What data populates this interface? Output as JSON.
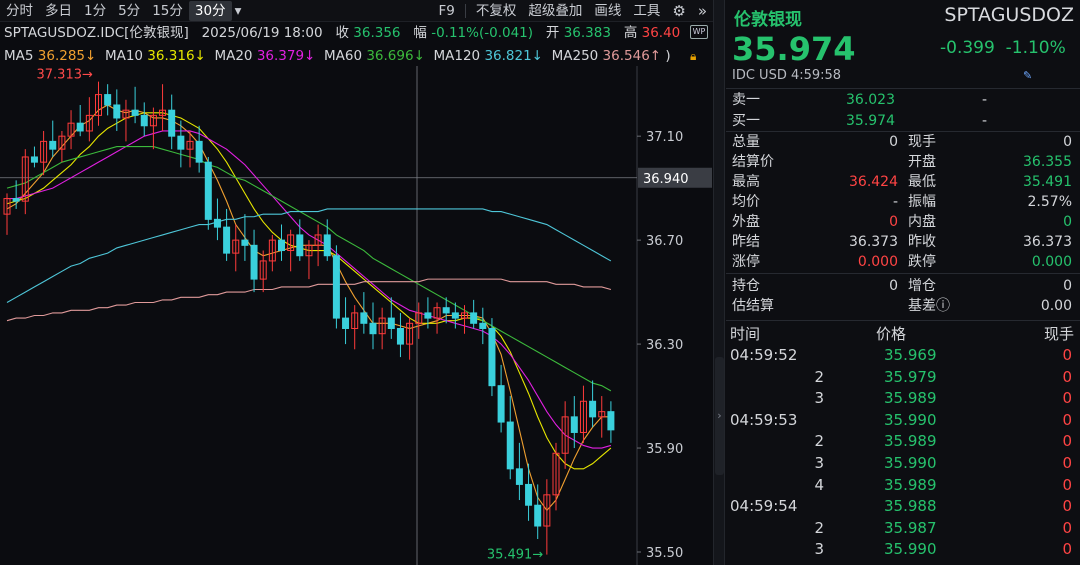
{
  "toolbar": {
    "items": [
      "分时",
      "多日",
      "1分",
      "5分",
      "15分",
      "30分"
    ],
    "active_index": 5,
    "dropdown": "▾",
    "f9": "F9",
    "fq": "不复权",
    "overlay": "超级叠加",
    "draw": "画线",
    "tools": "工具"
  },
  "info": {
    "code": "SPTAGUSDOZ.IDC[伦敦银现]",
    "datetime": "2025/06/19 18:00",
    "close_label": "收",
    "close": "36.356",
    "amp_label": "幅",
    "amp": "-0.11%(-0.041)",
    "open_label": "开",
    "open": "36.383",
    "high_label": "高",
    "high": "36.40"
  },
  "ma": [
    {
      "label": "MA5",
      "value": "36.285↓",
      "color": "#f0a030"
    },
    {
      "label": "MA10",
      "value": "36.316↓",
      "color": "#e6e600"
    },
    {
      "label": "MA20",
      "value": "36.379↓",
      "color": "#e020e0"
    },
    {
      "label": "MA60",
      "value": "36.696↓",
      "color": "#3cba3c"
    },
    {
      "label": "MA120",
      "value": "36.821↓",
      "color": "#4ec6d8"
    },
    {
      "label": "MA250",
      "value": "36.546↑",
      "color": "#e09a9a"
    }
  ],
  "ma_tail": ")",
  "wp_badge": "WP",
  "lock_icon": "lock-icon",
  "chart_data": {
    "type": "candlestick",
    "y_ticks": [
      37.1,
      36.7,
      36.3,
      35.9,
      35.5
    ],
    "ylim": [
      35.45,
      37.37
    ],
    "crosshair": {
      "price": "36.940"
    },
    "max_label": "37.313",
    "min_label": "35.491",
    "up_color": "#ff3b3b",
    "down_color": "#3ad0dc",
    "bars": [
      [
        36.8,
        36.88,
        36.72,
        36.86
      ],
      [
        36.86,
        36.93,
        36.82,
        36.85
      ],
      [
        36.85,
        37.05,
        36.8,
        37.02
      ],
      [
        37.02,
        37.06,
        36.98,
        37.0
      ],
      [
        37.0,
        37.12,
        36.95,
        37.08
      ],
      [
        37.08,
        37.16,
        37.02,
        37.05
      ],
      [
        37.05,
        37.12,
        37.0,
        37.1
      ],
      [
        37.1,
        37.2,
        37.05,
        37.15
      ],
      [
        37.15,
        37.22,
        37.1,
        37.12
      ],
      [
        37.12,
        37.25,
        37.08,
        37.18
      ],
      [
        37.18,
        37.31,
        37.14,
        37.26
      ],
      [
        37.26,
        37.3,
        37.18,
        37.22
      ],
      [
        37.22,
        37.28,
        37.12,
        37.17
      ],
      [
        37.17,
        37.24,
        37.08,
        37.2
      ],
      [
        37.2,
        37.29,
        37.15,
        37.18
      ],
      [
        37.18,
        37.23,
        37.1,
        37.14
      ],
      [
        37.14,
        37.21,
        37.05,
        37.18
      ],
      [
        37.18,
        37.3,
        37.12,
        37.2
      ],
      [
        37.2,
        37.26,
        37.05,
        37.1
      ],
      [
        37.1,
        37.16,
        36.98,
        37.05
      ],
      [
        37.05,
        37.12,
        36.98,
        37.08
      ],
      [
        37.08,
        37.14,
        36.96,
        37.0
      ],
      [
        37.0,
        37.02,
        36.74,
        36.78
      ],
      [
        36.78,
        36.86,
        36.7,
        36.75
      ],
      [
        36.75,
        36.82,
        36.62,
        36.65
      ],
      [
        36.65,
        36.76,
        36.58,
        36.7
      ],
      [
        36.7,
        36.8,
        36.62,
        36.68
      ],
      [
        36.68,
        36.74,
        36.5,
        36.55
      ],
      [
        36.55,
        36.66,
        36.5,
        36.62
      ],
      [
        36.62,
        36.72,
        36.58,
        36.7
      ],
      [
        36.7,
        36.76,
        36.62,
        36.66
      ],
      [
        36.66,
        36.74,
        36.58,
        36.72
      ],
      [
        36.72,
        36.78,
        36.62,
        36.64
      ],
      [
        36.64,
        36.7,
        36.55,
        36.68
      ],
      [
        36.68,
        36.76,
        36.6,
        36.72
      ],
      [
        36.72,
        36.78,
        36.62,
        36.64
      ],
      [
        36.64,
        36.68,
        36.36,
        36.4
      ],
      [
        36.4,
        36.48,
        36.3,
        36.36
      ],
      [
        36.36,
        36.45,
        36.28,
        36.42
      ],
      [
        36.42,
        36.5,
        36.34,
        36.38
      ],
      [
        36.38,
        36.46,
        36.28,
        36.34
      ],
      [
        36.34,
        36.44,
        36.28,
        36.4
      ],
      [
        36.4,
        36.48,
        36.32,
        36.36
      ],
      [
        36.36,
        36.42,
        36.25,
        36.3
      ],
      [
        36.3,
        36.4,
        36.24,
        36.38
      ],
      [
        36.38,
        36.46,
        36.32,
        36.42
      ],
      [
        36.42,
        36.48,
        36.36,
        36.4
      ],
      [
        36.4,
        36.46,
        36.34,
        36.44
      ],
      [
        36.44,
        36.48,
        36.38,
        36.42
      ],
      [
        36.42,
        36.46,
        36.36,
        36.4
      ],
      [
        36.4,
        36.45,
        36.34,
        36.42
      ],
      [
        36.42,
        36.47,
        36.36,
        36.38
      ],
      [
        36.38,
        36.44,
        36.3,
        36.36
      ],
      [
        36.36,
        36.4,
        36.1,
        36.14
      ],
      [
        36.14,
        36.22,
        35.96,
        36.0
      ],
      [
        36.0,
        36.1,
        35.78,
        35.82
      ],
      [
        35.82,
        35.92,
        35.7,
        35.76
      ],
      [
        35.76,
        35.84,
        35.62,
        35.68
      ],
      [
        35.68,
        35.76,
        35.55,
        35.6
      ],
      [
        35.6,
        35.78,
        35.49,
        35.72
      ],
      [
        35.72,
        35.92,
        35.66,
        35.88
      ],
      [
        35.88,
        36.08,
        35.82,
        36.02
      ],
      [
        36.02,
        36.1,
        35.9,
        35.96
      ],
      [
        35.96,
        36.14,
        35.92,
        36.08
      ],
      [
        36.08,
        36.16,
        35.98,
        36.02
      ],
      [
        36.02,
        36.1,
        35.94,
        36.04
      ],
      [
        36.04,
        36.08,
        35.92,
        35.97
      ]
    ],
    "ma_lines": {
      "MA5": [
        36.82,
        36.84,
        36.88,
        36.92,
        36.96,
        37.02,
        37.06,
        37.1,
        37.14,
        37.16,
        37.2,
        37.22,
        37.2,
        37.19,
        37.2,
        37.19,
        37.17,
        37.17,
        37.16,
        37.14,
        37.11,
        37.07,
        37.0,
        36.93,
        36.85,
        36.76,
        36.71,
        36.66,
        36.64,
        36.65,
        36.66,
        36.67,
        36.68,
        36.68,
        36.68,
        36.68,
        36.61,
        36.54,
        36.48,
        36.43,
        36.38,
        36.38,
        36.38,
        36.37,
        36.36,
        36.37,
        36.38,
        36.39,
        36.41,
        36.41,
        36.41,
        36.41,
        36.4,
        36.34,
        36.26,
        36.12,
        35.97,
        35.82,
        35.71,
        35.66,
        35.7,
        35.78,
        35.86,
        35.93,
        35.98,
        36.02,
        36.02
      ],
      "MA10": [
        36.84,
        36.85,
        36.86,
        36.88,
        36.9,
        36.93,
        36.96,
        36.99,
        37.03,
        37.06,
        37.1,
        37.13,
        37.15,
        37.17,
        37.18,
        37.19,
        37.19,
        37.19,
        37.18,
        37.17,
        37.15,
        37.13,
        37.09,
        37.05,
        37.0,
        36.94,
        36.88,
        36.82,
        36.77,
        36.73,
        36.7,
        36.68,
        36.67,
        36.66,
        36.66,
        36.66,
        36.64,
        36.61,
        36.58,
        36.55,
        36.52,
        36.49,
        36.46,
        36.43,
        36.4,
        36.38,
        36.38,
        36.38,
        36.39,
        36.39,
        36.4,
        36.4,
        36.39,
        36.37,
        36.33,
        36.27,
        36.19,
        36.11,
        36.02,
        35.94,
        35.88,
        35.84,
        35.82,
        35.82,
        35.84,
        35.87,
        35.9
      ],
      "MA20": [
        36.86,
        36.86,
        36.87,
        36.88,
        36.89,
        36.9,
        36.92,
        36.94,
        36.96,
        36.98,
        37.0,
        37.02,
        37.04,
        37.06,
        37.08,
        37.1,
        37.11,
        37.12,
        37.12,
        37.12,
        37.12,
        37.11,
        37.09,
        37.07,
        37.05,
        37.02,
        36.99,
        36.95,
        36.91,
        36.87,
        36.83,
        36.79,
        36.75,
        36.72,
        36.7,
        36.68,
        36.65,
        36.62,
        36.59,
        36.56,
        36.53,
        36.5,
        36.47,
        36.45,
        36.43,
        36.42,
        36.41,
        36.4,
        36.39,
        36.38,
        36.37,
        36.36,
        36.35,
        36.33,
        36.3,
        36.26,
        36.21,
        36.16,
        36.1,
        36.04,
        35.99,
        35.95,
        35.93,
        35.91,
        35.9,
        35.9,
        35.91
      ],
      "MA60": [
        36.9,
        36.91,
        36.92,
        36.94,
        36.96,
        36.98,
        37.0,
        37.01,
        37.02,
        37.03,
        37.04,
        37.05,
        37.06,
        37.06,
        37.06,
        37.06,
        37.06,
        37.05,
        37.04,
        37.03,
        37.02,
        37.01,
        36.99,
        36.98,
        36.96,
        36.94,
        36.93,
        36.91,
        36.89,
        36.87,
        36.85,
        36.83,
        36.81,
        36.79,
        36.77,
        36.75,
        36.72,
        36.7,
        36.68,
        36.66,
        36.63,
        36.61,
        36.59,
        36.57,
        36.55,
        36.53,
        36.51,
        36.49,
        36.47,
        36.45,
        36.43,
        36.41,
        36.39,
        36.37,
        36.35,
        36.33,
        36.31,
        36.29,
        36.27,
        36.25,
        36.23,
        36.21,
        36.19,
        36.17,
        36.15,
        36.14,
        36.12
      ],
      "MA120": [
        36.46,
        36.48,
        36.5,
        36.52,
        36.54,
        36.56,
        36.58,
        36.6,
        36.61,
        36.63,
        36.64,
        36.65,
        36.67,
        36.68,
        36.69,
        36.7,
        36.71,
        36.72,
        36.73,
        36.74,
        36.75,
        36.76,
        36.76,
        36.77,
        36.78,
        36.78,
        36.79,
        36.79,
        36.8,
        36.8,
        36.8,
        36.81,
        36.81,
        36.81,
        36.81,
        36.82,
        36.82,
        36.82,
        36.82,
        36.82,
        36.82,
        36.82,
        36.82,
        36.82,
        36.82,
        36.82,
        36.82,
        36.82,
        36.82,
        36.82,
        36.82,
        36.82,
        36.82,
        36.81,
        36.81,
        36.8,
        36.79,
        36.78,
        36.77,
        36.76,
        36.74,
        36.72,
        36.7,
        36.68,
        36.66,
        36.64,
        36.62
      ],
      "MA250": [
        36.39,
        36.4,
        36.4,
        36.41,
        36.41,
        36.42,
        36.42,
        36.43,
        36.43,
        36.43,
        36.44,
        36.44,
        36.45,
        36.45,
        36.46,
        36.46,
        36.46,
        36.47,
        36.47,
        36.48,
        36.48,
        36.48,
        36.49,
        36.49,
        36.5,
        36.5,
        36.5,
        36.51,
        36.51,
        36.51,
        36.52,
        36.52,
        36.52,
        36.52,
        36.53,
        36.53,
        36.53,
        36.53,
        36.53,
        36.54,
        36.54,
        36.54,
        36.54,
        36.54,
        36.54,
        36.54,
        36.55,
        36.55,
        36.55,
        36.55,
        36.55,
        36.55,
        36.55,
        36.55,
        36.55,
        36.54,
        36.54,
        36.54,
        36.54,
        36.54,
        36.53,
        36.53,
        36.53,
        36.52,
        36.52,
        36.52,
        36.51
      ]
    }
  },
  "quote": {
    "name": "伦敦银现",
    "code": "SPTAGUSDOZ",
    "price": "35.974",
    "change": "-0.399",
    "change_pct": "-1.10%",
    "meta": "IDC  USD  4:59:58",
    "ask_label": "卖一",
    "ask": "36.023",
    "ask_vol": "-",
    "bid_label": "买一",
    "bid": "35.974",
    "bid_vol": "-",
    "stats": [
      {
        "l1": "总量",
        "v1": "0",
        "c1": "wh",
        "l2": "现手",
        "v2": "0",
        "c2": "wh"
      },
      {
        "l1": "结算价",
        "v1": "",
        "c1": "wh",
        "l2": "开盘",
        "v2": "36.355",
        "c2": "gr"
      },
      {
        "l1": "最高",
        "v1": "36.424",
        "c1": "rd",
        "l2": "最低",
        "v2": "35.491",
        "c2": "gr"
      },
      {
        "l1": "均价",
        "v1": "-",
        "c1": "wh",
        "l2": "振幅",
        "v2": "2.57%",
        "c2": "wh"
      },
      {
        "l1": "外盘",
        "v1": "0",
        "c1": "rd",
        "l2": "内盘",
        "v2": "0",
        "c2": "gr"
      },
      {
        "l1": "昨结",
        "v1": "36.373",
        "c1": "wh",
        "l2": "昨收",
        "v2": "36.373",
        "c2": "wh"
      },
      {
        "l1": "涨停",
        "v1": "0.000",
        "c1": "rd",
        "l2": "跌停",
        "v2": "0.000",
        "c2": "gr"
      }
    ],
    "stats2": [
      {
        "l1": "持仓",
        "v1": "0",
        "c1": "wh",
        "l2": "增仓",
        "v2": "0",
        "c2": "wh"
      },
      {
        "l1": "估结算",
        "v1": "",
        "c1": "wh",
        "l2": "基差ⓘ",
        "v2": "0.00",
        "c2": "wh"
      }
    ],
    "ticks_header": {
      "time": "时间",
      "price": "价格",
      "vol": "现手"
    },
    "ticks": [
      {
        "t": "04:59:52",
        "p": "35.969",
        "v": "0"
      },
      {
        "t": "2",
        "p": "35.979",
        "v": "0"
      },
      {
        "t": "3",
        "p": "35.989",
        "v": "0"
      },
      {
        "t": "04:59:53",
        "p": "35.990",
        "v": "0"
      },
      {
        "t": "2",
        "p": "35.989",
        "v": "0"
      },
      {
        "t": "3",
        "p": "35.990",
        "v": "0"
      },
      {
        "t": "4",
        "p": "35.989",
        "v": "0"
      },
      {
        "t": "04:59:54",
        "p": "35.988",
        "v": "0"
      },
      {
        "t": "2",
        "p": "35.987",
        "v": "0"
      },
      {
        "t": "3",
        "p": "35.990",
        "v": "0"
      }
    ]
  },
  "divider_handle": "›"
}
